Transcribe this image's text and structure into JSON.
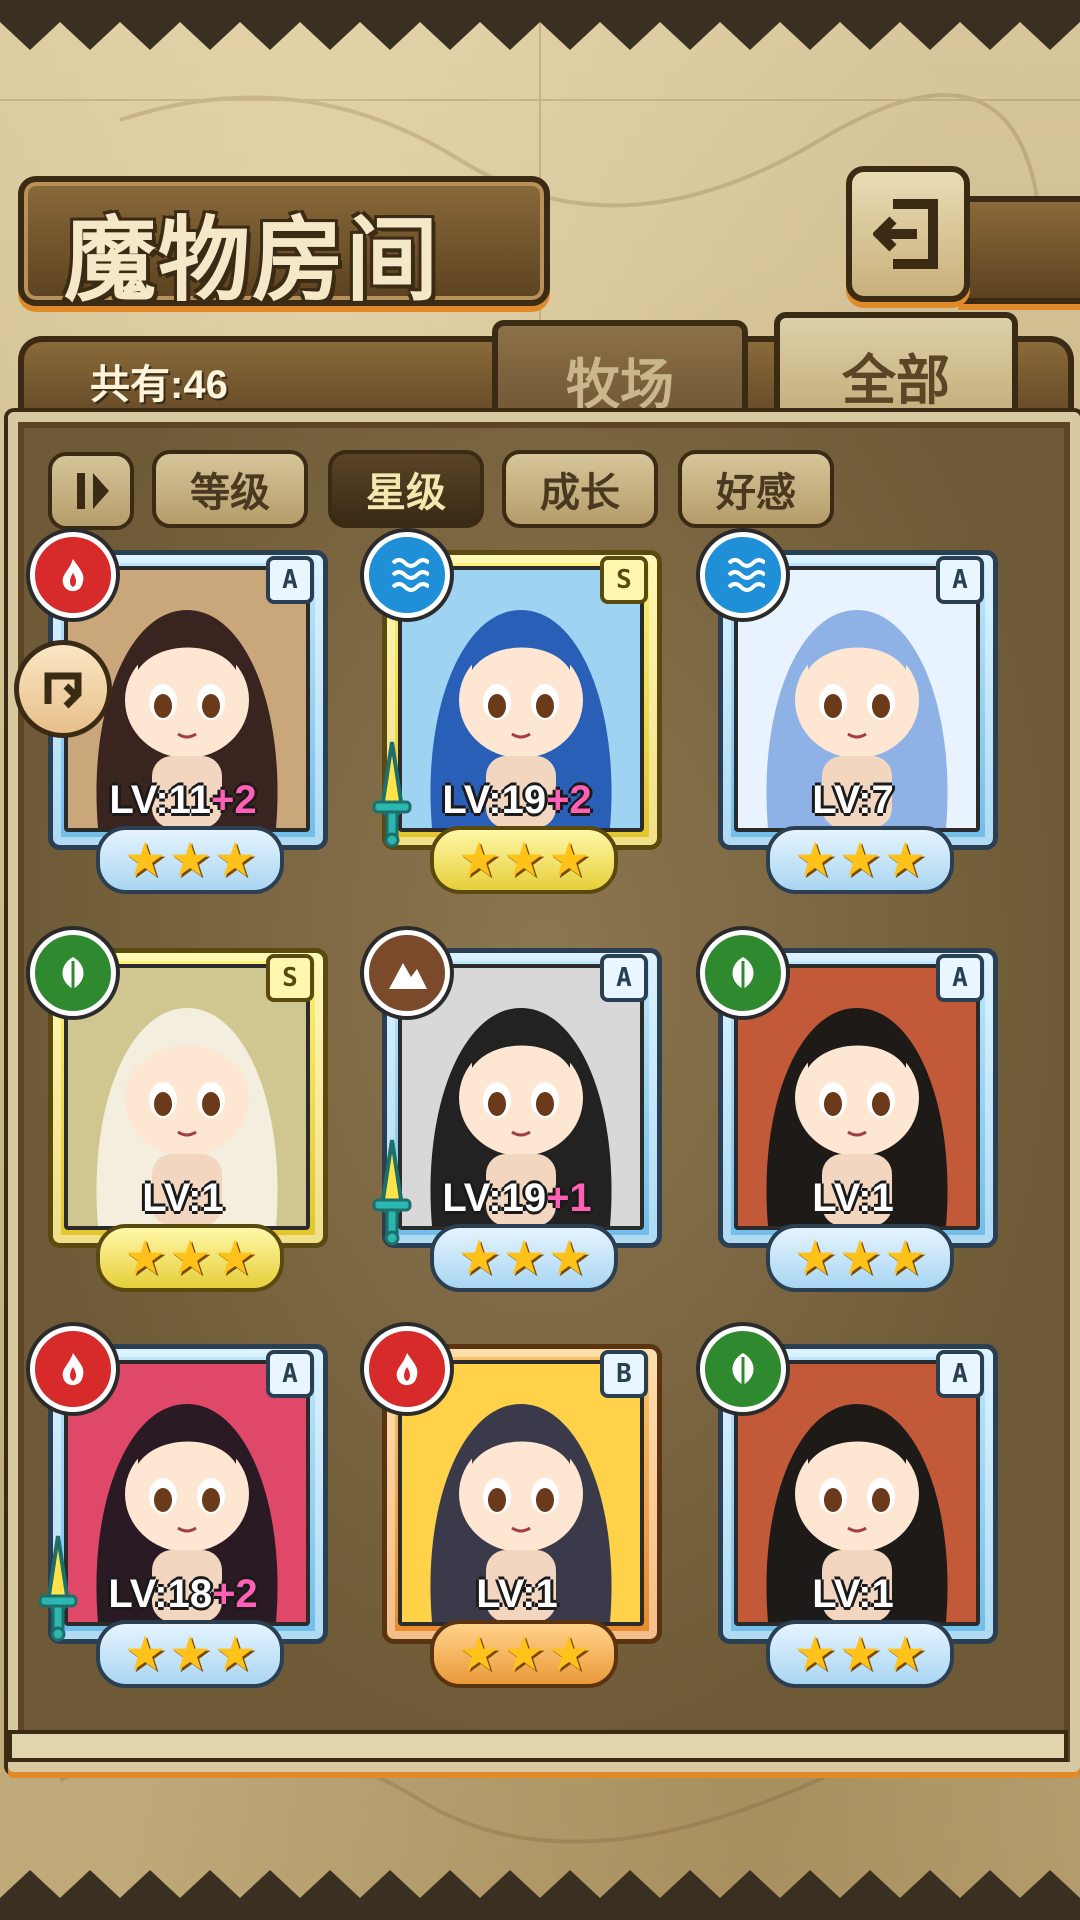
{
  "title": "魔物房间",
  "count_label": "共有:46",
  "tabs": {
    "pasture": "牧场",
    "all": "全部"
  },
  "sort_buttons": [
    "等级",
    "星级",
    "成长",
    "好感"
  ],
  "active_sort": "星级",
  "colors": {
    "fire": "#d72a2a",
    "water": "#1f8fd8",
    "wood": "#2f8a2f",
    "earth": "#7a4a2a",
    "frame_blue": "#6fbde8",
    "frame_gold": "#e2c52a",
    "frame_orange": "#e8892a",
    "plus_text": "#ff5fb4"
  },
  "monsters": [
    {
      "element": "fire-icon",
      "rank": "A",
      "lv": "LV:11",
      "plus": "+2",
      "stars": 3,
      "frame": "blue",
      "equipped": false,
      "portrait_colors": [
        "#c9a77a",
        "#3a2420"
      ]
    },
    {
      "element": "water-icon",
      "rank": "S",
      "lv": "LV:19",
      "plus": "+2",
      "stars": 3,
      "frame": "gold",
      "equipped": true,
      "portrait_colors": [
        "#9fd3f2",
        "#2a5fb8"
      ]
    },
    {
      "element": "water-icon",
      "rank": "A",
      "lv": "LV:7",
      "plus": "",
      "stars": 3,
      "frame": "blue",
      "equipped": false,
      "portrait_colors": [
        "#e8f3ff",
        "#8fb2e6"
      ]
    },
    {
      "element": "wood-icon",
      "rank": "S",
      "lv": "LV:1",
      "plus": "",
      "stars": 3,
      "frame": "gold",
      "equipped": false,
      "portrait_colors": [
        "#cfc78f",
        "#f4eede"
      ]
    },
    {
      "element": "earth-icon",
      "rank": "A",
      "lv": "LV:19",
      "plus": "+1",
      "stars": 3,
      "frame": "blue",
      "equipped": true,
      "portrait_colors": [
        "#d8d8d8",
        "#222222"
      ]
    },
    {
      "element": "wood-icon",
      "rank": "A",
      "lv": "LV:1",
      "plus": "",
      "stars": 3,
      "frame": "blue",
      "equipped": false,
      "portrait_colors": [
        "#c25a3a",
        "#1e1a18"
      ]
    },
    {
      "element": "fire-icon",
      "rank": "A",
      "lv": "LV:18",
      "plus": "+2",
      "stars": 3,
      "frame": "blue",
      "equipped": true,
      "portrait_colors": [
        "#e0486a",
        "#2a1a24"
      ]
    },
    {
      "element": "fire-icon",
      "rank": "B",
      "lv": "LV:1",
      "plus": "",
      "stars": 3,
      "frame": "orange",
      "equipped": false,
      "portrait_colors": [
        "#ffd24a",
        "#3a3a4a"
      ]
    },
    {
      "element": "wood-icon",
      "rank": "A",
      "lv": "LV:1",
      "plus": "",
      "stars": 3,
      "frame": "blue",
      "equipped": false,
      "portrait_colors": [
        "#c25a3a",
        "#1e1a18"
      ]
    }
  ]
}
